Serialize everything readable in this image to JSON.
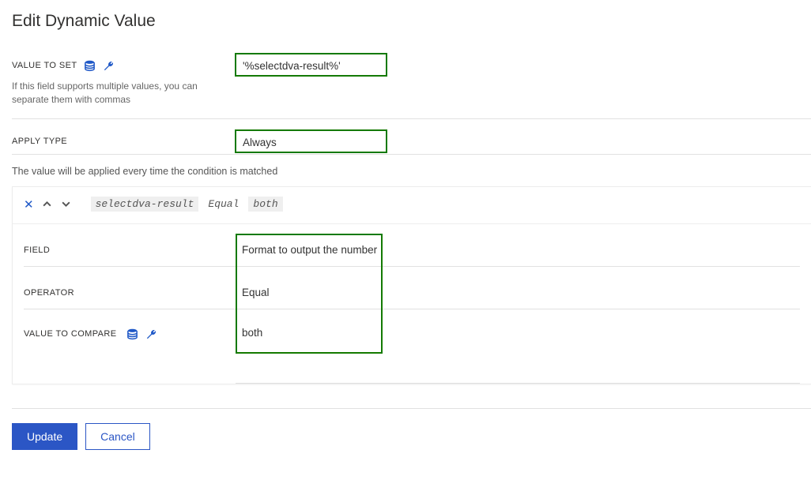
{
  "title": "Edit Dynamic Value",
  "valueToSet": {
    "label": "VALUE TO SET",
    "help": "If this field supports multiple values, you can separate them with commas",
    "value": "'%selectdva-result%'"
  },
  "applyType": {
    "label": "APPLY TYPE",
    "value": "Always",
    "description": "The value will be applied every time the condition is matched"
  },
  "condition": {
    "summary": {
      "field": "selectdva-result",
      "operator": "Equal",
      "value": "both"
    },
    "fieldLabel": "FIELD",
    "fieldValue": "Format to output the number",
    "operatorLabel": "OPERATOR",
    "operatorValue": "Equal",
    "compareLabel": "VALUE TO COMPARE",
    "compareValue": "both"
  },
  "buttons": {
    "update": "Update",
    "cancel": "Cancel"
  }
}
